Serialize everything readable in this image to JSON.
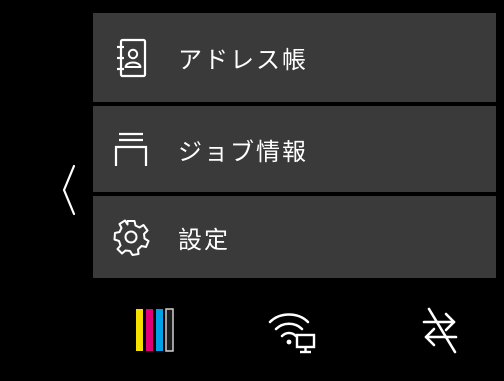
{
  "menu": {
    "back_icon": "chevron-left-icon",
    "items": [
      {
        "label": "アドレス帳",
        "icon": "address-book-icon"
      },
      {
        "label": "ジョブ情報",
        "icon": "job-tray-icon"
      },
      {
        "label": "設定",
        "icon": "gear-icon"
      }
    ]
  },
  "status_bar": {
    "ink": {
      "icon": "ink-levels-icon",
      "colors": [
        "#f5e100",
        "#e0007a",
        "#00a0e6",
        "#1a1a1a"
      ]
    },
    "network": {
      "icon": "wifi-network-icon"
    },
    "transfer": {
      "icon": "data-transfer-disabled-icon"
    }
  },
  "colors": {
    "background": "#000000",
    "menu_item_bg": "#3a3a3a",
    "foreground": "#ffffff"
  }
}
